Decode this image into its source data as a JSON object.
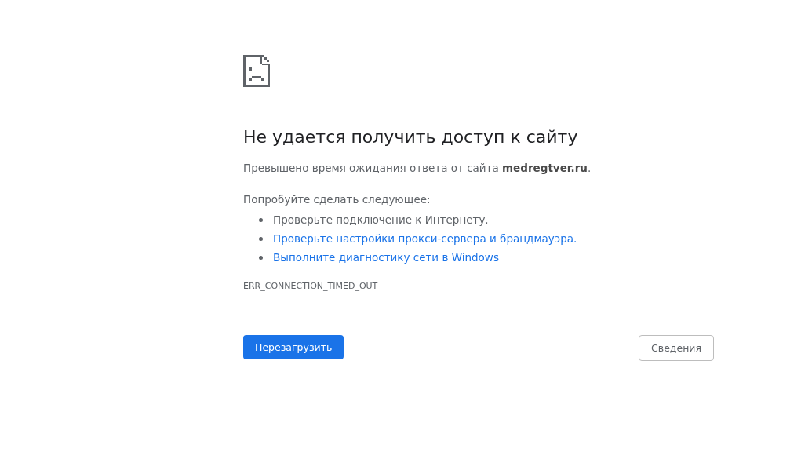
{
  "heading": "Не удается получить доступ к сайту",
  "message": "Превышено время ожидания ответа от сайта **medregtver.ru**.",
  "suggestions_intro": "Попробуйте сделать следующее:",
  "suggestions": [
    {
      "kind": "text",
      "text": "Проверьте подключение к Интернету."
    },
    {
      "kind": "link",
      "text": "Проверьте настройки прокси-сервера и брандмауэра."
    },
    {
      "kind": "link",
      "text": "Выполните диагностику сети в Windows"
    }
  ],
  "error_code": "ERR_CONNECTION_TIMED_OUT",
  "buttons": [
    {
      "kind": "primary",
      "label": "Перезагрузить"
    },
    {
      "kind": "secondary",
      "label": "Сведения"
    }
  ]
}
